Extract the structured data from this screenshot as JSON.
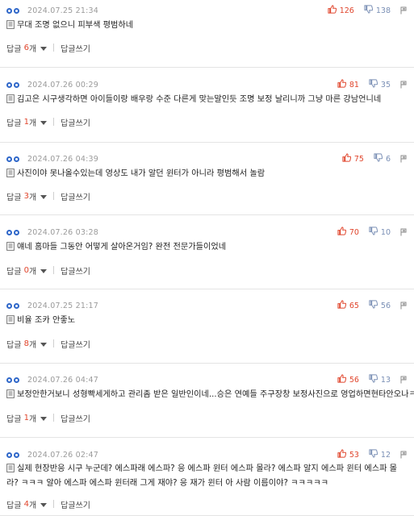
{
  "labels": {
    "reply_prefix": "답글",
    "reply_suffix": "개",
    "write_reply": "답글쓰기"
  },
  "comments": [
    {
      "time": "2024.07.25 21:34",
      "up": "126",
      "down": "138",
      "text": "무대 조명 없으니 피부색 평범하네",
      "replies": "6"
    },
    {
      "time": "2024.07.26 00:29",
      "up": "81",
      "down": "35",
      "text": "김고은 시구생각하면 아이들이랑 배우랑 수준 다른게 맞는말인듯 조명 보정 날리니까 그냥 마른 강남언니네",
      "replies": "1"
    },
    {
      "time": "2024.07.26 04:39",
      "up": "75",
      "down": "6",
      "text": "사진이야 못나올수있는데 영상도 내가 알던 윈터가 아니라 평범해서 놀람",
      "replies": "3"
    },
    {
      "time": "2024.07.26 03:28",
      "up": "70",
      "down": "10",
      "text": "얘네 홈마들 그동안 어떻게 살아온거임? 완전 전문가들이었네",
      "replies": "0"
    },
    {
      "time": "2024.07.25 21:17",
      "up": "65",
      "down": "56",
      "text": "비율 조카 안좋노",
      "replies": "8"
    },
    {
      "time": "2024.07.26 04:47",
      "up": "56",
      "down": "13",
      "text": "보정안한거보니 성형빡세게하고 관리좀 받은 일반인이네...승은 연예들 주구장창 보정사진으로 영업하면현타안오나ㅋ",
      "replies": "1"
    },
    {
      "time": "2024.07.26 02:47",
      "up": "53",
      "down": "12",
      "text": "실제 현장반응 시구 누군데? 에스파래 에스파? 응 에스파 윈터 에스파 몰라? 에스파 알지 에스파 윈터 에스파 몰라? ㅋㅋㅋ 알아 에스파 에스파 윈터래 그게 재야? 응 재가 윈터 아 사람 이름이야? ㅋㅋㅋㅋㅋ",
      "replies": "4"
    }
  ],
  "colors": {
    "accent_blue": "#2f67c9",
    "upvote_red": "#e0452c",
    "downvote_blue": "#7a8fb5"
  },
  "icons": [
    "dots-icon",
    "thumbs-up-icon",
    "thumbs-down-icon",
    "report-icon",
    "memo-icon",
    "chevron-down-icon"
  ]
}
